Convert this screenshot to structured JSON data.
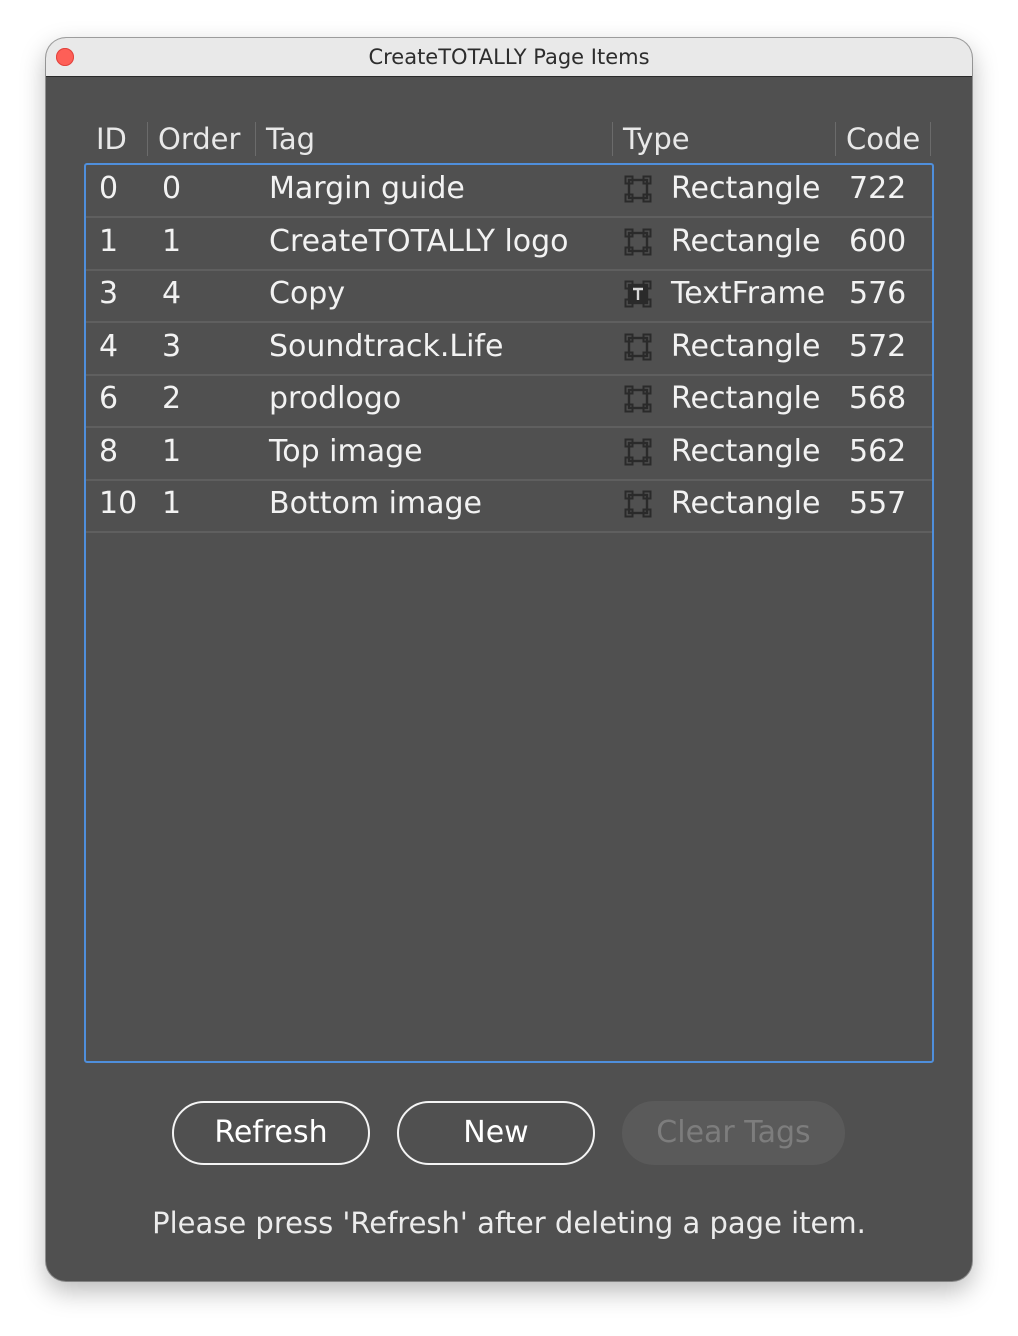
{
  "window": {
    "title": "CreateTOTALLY Page Items"
  },
  "table": {
    "columns": [
      "ID",
      "Order",
      "Tag",
      "Type",
      "Code"
    ],
    "rows": [
      {
        "id": "0",
        "order": "0",
        "tag": "Margin guide",
        "type": "Rectangle",
        "icon": "rectangle-frame-icon",
        "code": "722"
      },
      {
        "id": "1",
        "order": "1",
        "tag": "CreateTOTALLY logo",
        "type": "Rectangle",
        "icon": "rectangle-frame-icon",
        "code": "600"
      },
      {
        "id": "3",
        "order": "4",
        "tag": "Copy",
        "type": "TextFrame",
        "icon": "text-frame-icon",
        "code": "576"
      },
      {
        "id": "4",
        "order": "3",
        "tag": "Soundtrack.Life",
        "type": "Rectangle",
        "icon": "rectangle-frame-icon",
        "code": "572"
      },
      {
        "id": "6",
        "order": "2",
        "tag": "prodlogo",
        "type": "Rectangle",
        "icon": "rectangle-frame-icon",
        "code": "568"
      },
      {
        "id": "8",
        "order": "1",
        "tag": "Top image",
        "type": "Rectangle",
        "icon": "rectangle-frame-icon",
        "code": "562"
      },
      {
        "id": "10",
        "order": "1",
        "tag": "Bottom image",
        "type": "Rectangle",
        "icon": "rectangle-frame-icon",
        "code": "557"
      }
    ]
  },
  "buttons": {
    "refresh": "Refresh",
    "new": "New",
    "clear_tags": "Clear Tags"
  },
  "hint": "Please press 'Refresh' after deleting a page item.",
  "colors": {
    "accent": "#4f8fdc",
    "panel": "#505050",
    "close": "#fe5f57"
  }
}
